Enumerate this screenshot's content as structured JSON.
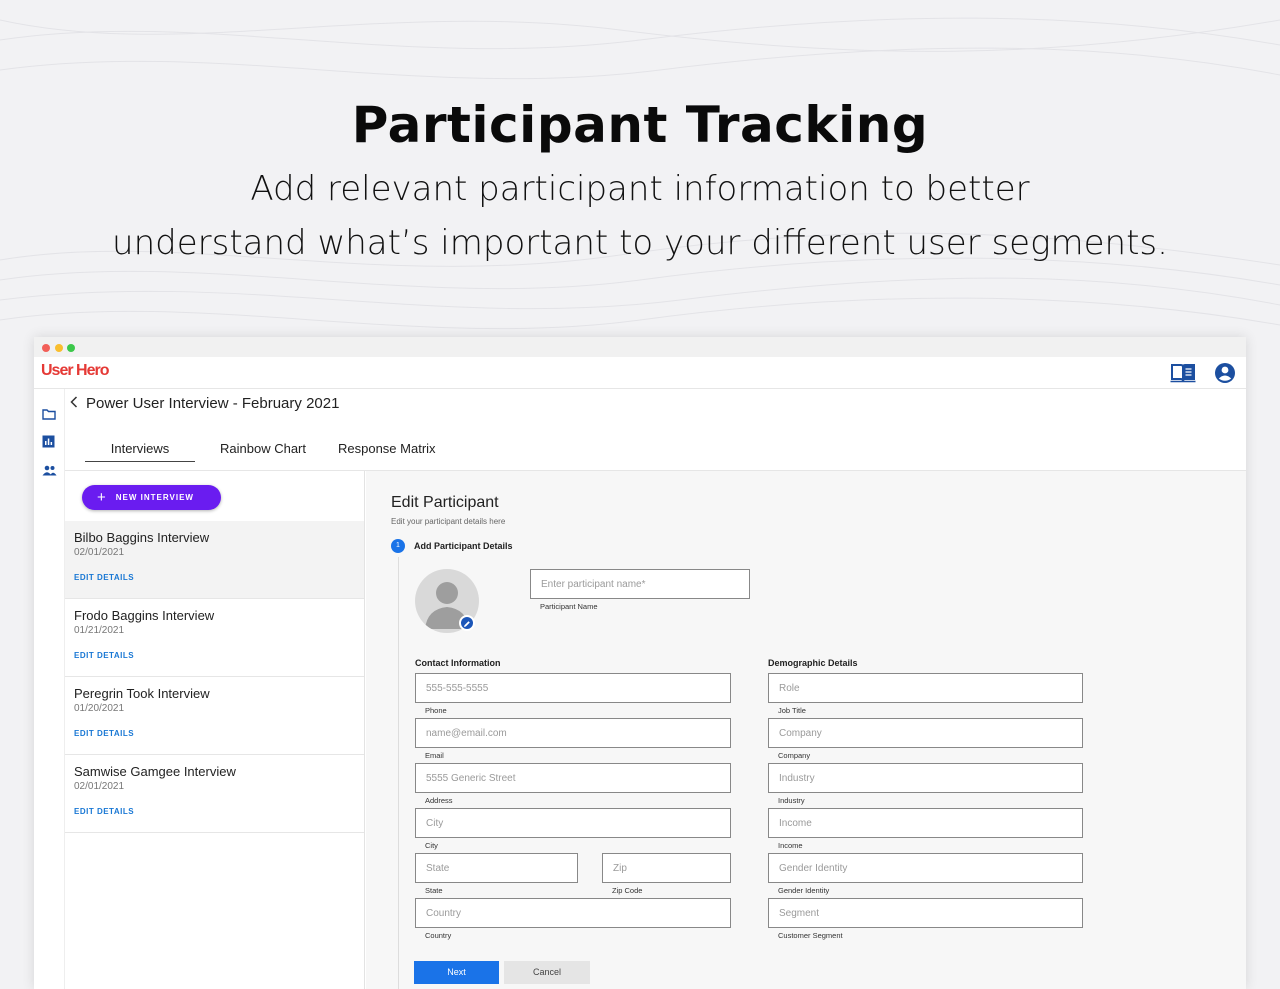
{
  "hero": {
    "title": "Participant Tracking",
    "subtitle_line1": "Add relevant participant information to better",
    "subtitle_line2": "understand what’s important to your different user segments."
  },
  "app": {
    "logo": "User Hero",
    "header_icons": [
      "book-icon",
      "account-icon"
    ],
    "rail_icons": [
      "folder-icon",
      "bar-chart-icon",
      "people-icon"
    ],
    "breadcrumb": "Power User Interview - February 2021",
    "tabs": [
      "Interviews",
      "Rainbow Chart",
      "Response Matrix"
    ],
    "active_tab": "Interviews",
    "new_interview_label": "NEW INTERVIEW",
    "interviews": [
      {
        "title": "Bilbo Baggins Interview",
        "date": "02/01/2021",
        "action": "EDIT DETAILS",
        "selected": true
      },
      {
        "title": "Frodo Baggins Interview",
        "date": "01/21/2021",
        "action": "EDIT DETAILS",
        "selected": false
      },
      {
        "title": "Peregrin Took Interview",
        "date": "01/20/2021",
        "action": "EDIT DETAILS",
        "selected": false
      },
      {
        "title": "Samwise Gamgee Interview",
        "date": "02/01/2021",
        "action": "EDIT DETAILS",
        "selected": false
      }
    ]
  },
  "form": {
    "title": "Edit Participant",
    "subtitle": "Edit your participant details here",
    "step_number": "1",
    "step_label": "Add Participant Details",
    "name": {
      "placeholder": "Enter participant name*",
      "label": "Participant Name"
    },
    "contact_heading": "Contact Information",
    "demographic_heading": "Demographic Details",
    "contact": {
      "phone": {
        "placeholder": "555-555-5555",
        "label": "Phone"
      },
      "email": {
        "placeholder": "name@email.com",
        "label": "Email"
      },
      "address": {
        "placeholder": "5555 Generic Street",
        "label": "Address"
      },
      "city": {
        "placeholder": "City",
        "label": "City"
      },
      "state": {
        "placeholder": "State",
        "label": "State"
      },
      "zip": {
        "placeholder": "Zip",
        "label": "Zip Code"
      },
      "country": {
        "placeholder": "Country",
        "label": "Country"
      }
    },
    "demographic": {
      "role": {
        "placeholder": "Role",
        "label": "Job Title"
      },
      "company": {
        "placeholder": "Company",
        "label": "Company"
      },
      "industry": {
        "placeholder": "Industry",
        "label": "Industry"
      },
      "income": {
        "placeholder": "Income",
        "label": "Income"
      },
      "gender": {
        "placeholder": "Gender Identity",
        "label": "Gender Identity"
      },
      "segment": {
        "placeholder": "Segment",
        "label": "Customer Segment"
      }
    },
    "next_label": "Next",
    "cancel_label": "Cancel"
  },
  "colors": {
    "brand_red": "#e53935",
    "primary_purple": "#6a1cf0",
    "primary_blue": "#1a73e8",
    "link_blue": "#1877d4"
  }
}
